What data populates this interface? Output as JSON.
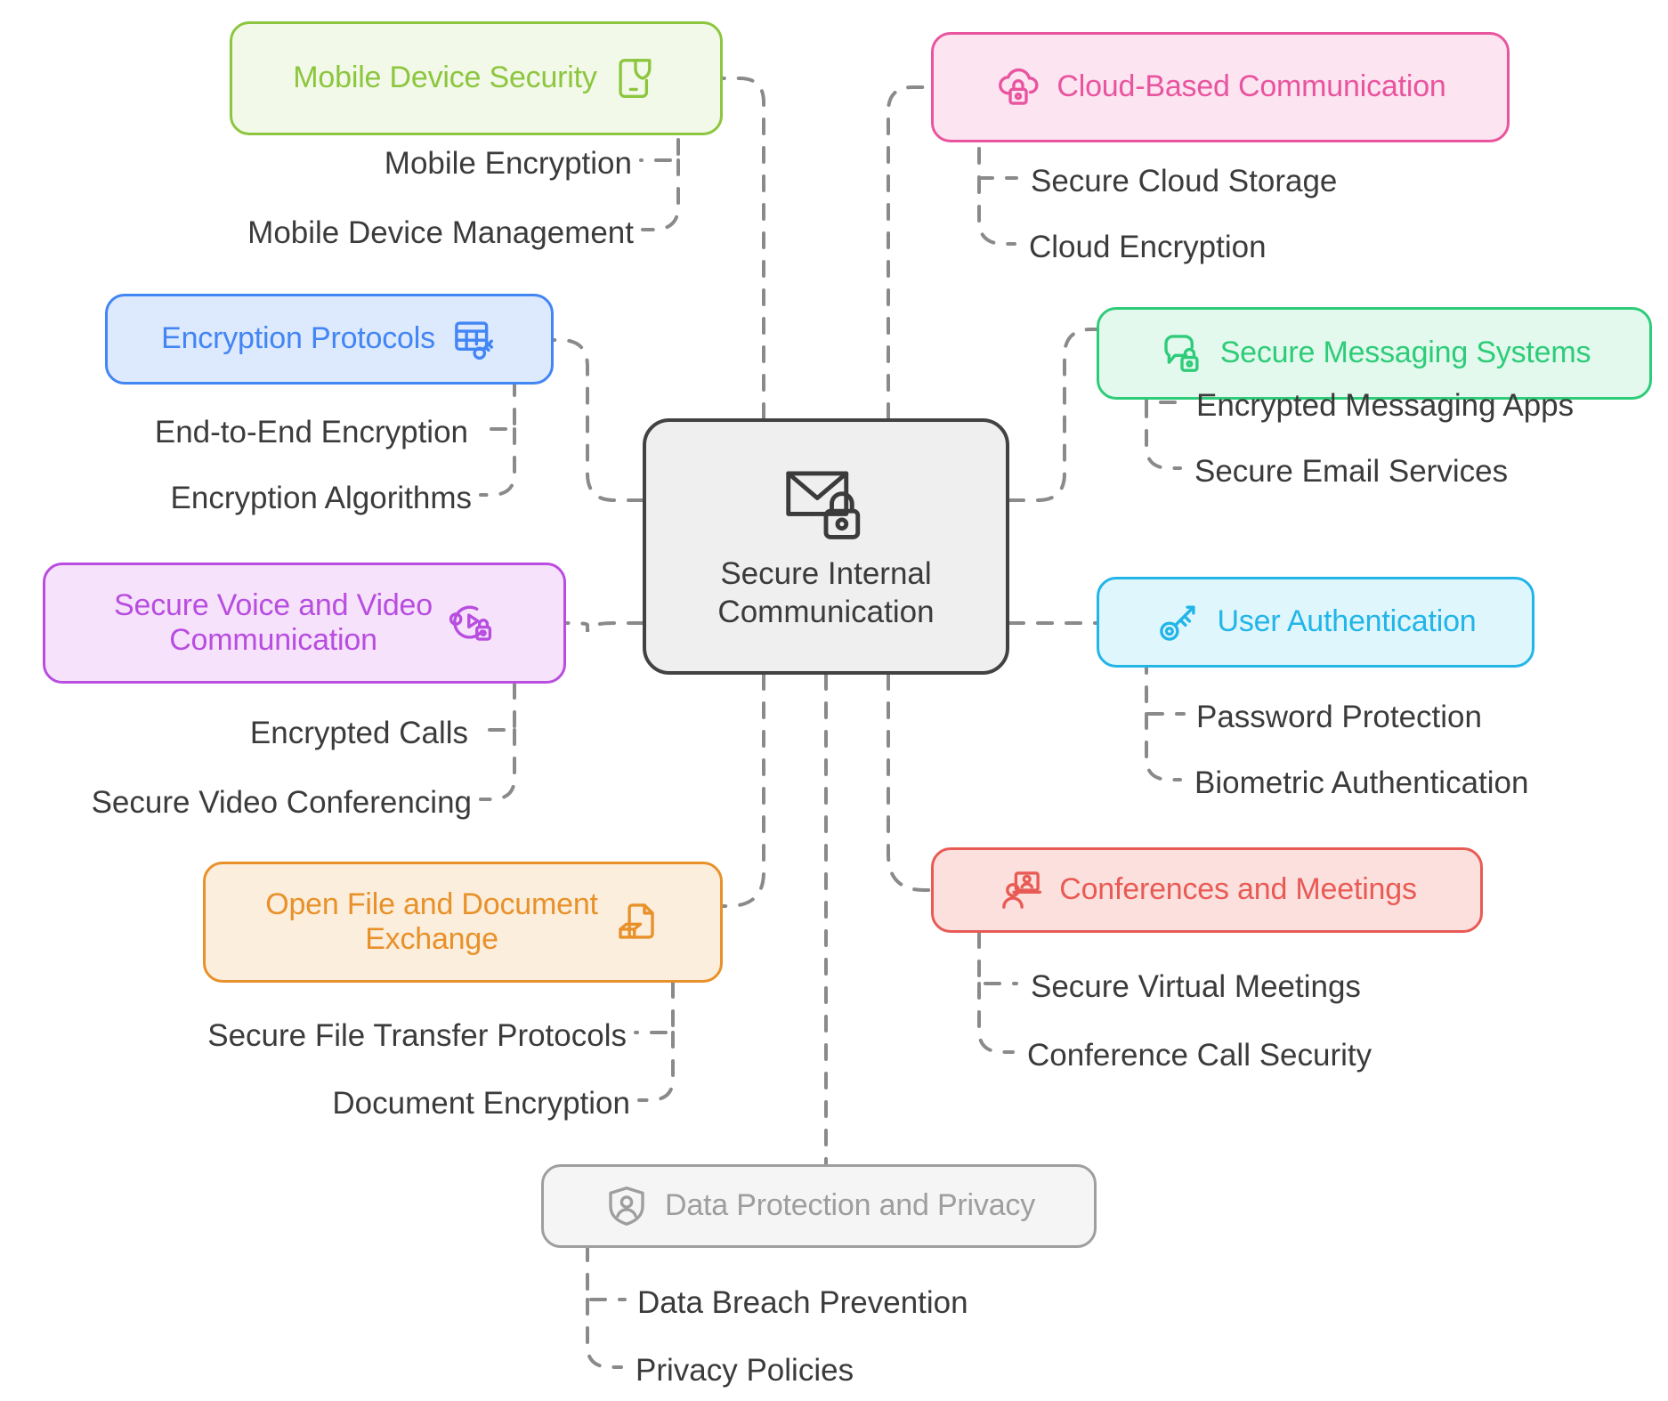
{
  "center": {
    "label": "Secure Internal\nCommunication",
    "icon": "envelope-lock-icon",
    "border_color": "#424242",
    "fill_color": "#efefef",
    "text_color": "#3b3b3b"
  },
  "edge_color": "#8a8a8a",
  "branches": [
    {
      "id": "mobile-device-security",
      "label": "Mobile Device Security",
      "icon": "phone-shield-icon",
      "icon_side": "right",
      "color": "#8CC63F",
      "fill": "#F3F9E8",
      "children": [
        {
          "label": "Mobile Encryption"
        },
        {
          "label": "Mobile Device Management"
        }
      ]
    },
    {
      "id": "cloud-based-communication",
      "label": "Cloud-Based Communication",
      "icon": "cloud-lock-icon",
      "icon_side": "left",
      "color": "#E9549F",
      "fill": "#FCE4F1",
      "children": [
        {
          "label": "Secure Cloud Storage"
        },
        {
          "label": "Cloud Encryption"
        }
      ]
    },
    {
      "id": "encryption-protocols",
      "label": "Encryption Protocols",
      "icon": "grid-key-icon",
      "icon_side": "right",
      "color": "#4285F4",
      "fill": "#DDE9FD",
      "children": [
        {
          "label": "End-to-End Encryption"
        },
        {
          "label": "Encryption Algorithms"
        }
      ]
    },
    {
      "id": "secure-messaging-systems",
      "label": "Secure Messaging Systems",
      "icon": "chat-lock-icon",
      "icon_side": "left",
      "color": "#2ECC79",
      "fill": "#E3F9ED",
      "children": [
        {
          "label": "Encrypted Messaging Apps"
        },
        {
          "label": "Secure Email Services"
        }
      ]
    },
    {
      "id": "secure-voice-and-video-communication",
      "label": "Secure Voice and Video\nCommunication",
      "icon": "video-lock-icon",
      "icon_side": "right",
      "color": "#B84DE0",
      "fill": "#F6E3FB",
      "children": [
        {
          "label": "Encrypted Calls"
        },
        {
          "label": "Secure Video Conferencing"
        }
      ]
    },
    {
      "id": "user-authentication",
      "label": "User Authentication",
      "icon": "key-icon",
      "icon_side": "left",
      "color": "#22B5E8",
      "fill": "#DFF6FD",
      "children": [
        {
          "label": "Password Protection"
        },
        {
          "label": "Biometric Authentication"
        }
      ]
    },
    {
      "id": "open-file-and-document-exchange",
      "label": "Open File and Document\nExchange",
      "icon": "document-exchange-icon",
      "icon_side": "right",
      "color": "#E8912A",
      "fill": "#FCEEDC",
      "children": [
        {
          "label": "Secure File Transfer Protocols"
        },
        {
          "label": "Document Encryption"
        }
      ]
    },
    {
      "id": "conferences-and-meetings",
      "label": "Conferences and Meetings",
      "icon": "presentation-person-icon",
      "icon_side": "left",
      "color": "#E85B55",
      "fill": "#FCE0DE",
      "children": [
        {
          "label": "Secure Virtual Meetings"
        },
        {
          "label": "Conference Call Security"
        }
      ]
    },
    {
      "id": "data-protection-and-privacy",
      "label": "Data Protection and Privacy",
      "icon": "shield-person-icon",
      "icon_side": "left",
      "color": "#9E9E9E",
      "fill": "#F5F5F5",
      "children": [
        {
          "label": "Data Breach Prevention"
        },
        {
          "label": "Privacy Policies"
        }
      ]
    }
  ]
}
